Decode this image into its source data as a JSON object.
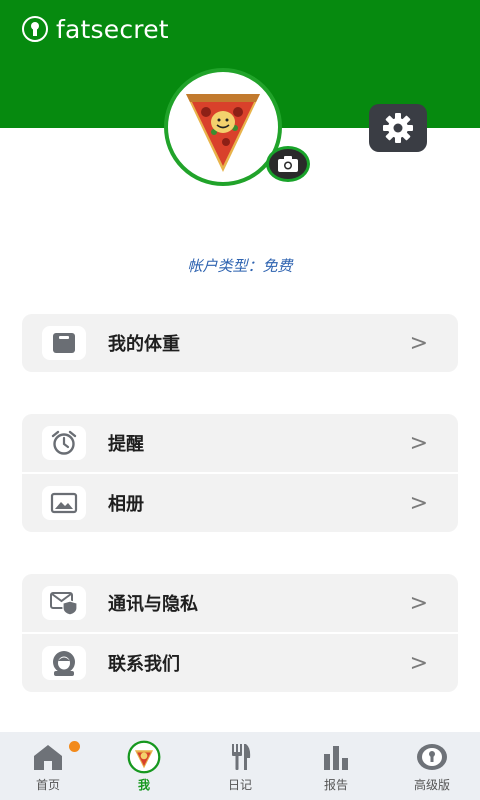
{
  "app": {
    "logo_text": "fatsecret"
  },
  "profile": {
    "account_type": "帐户类型：免费"
  },
  "menu": {
    "group1": [
      {
        "label": "我的体重",
        "icon": "scale-icon"
      }
    ],
    "group2": [
      {
        "label": "提醒",
        "icon": "alarm-clock-icon"
      },
      {
        "label": "相册",
        "icon": "photo-album-icon"
      }
    ],
    "group3": [
      {
        "label": "通讯与隐私",
        "icon": "mail-shield-icon"
      },
      {
        "label": "联系我们",
        "icon": "contact-support-icon"
      }
    ],
    "chevron": ">"
  },
  "tabs": [
    {
      "label": "首页",
      "icon": "home-icon"
    },
    {
      "label": "我",
      "icon": "pizza-avatar-icon"
    },
    {
      "label": "日记",
      "icon": "fork-knife-icon"
    },
    {
      "label": "报告",
      "icon": "bar-chart-icon"
    },
    {
      "label": "高级版",
      "icon": "premium-badge-icon"
    }
  ],
  "colors": {
    "brand_green": "#068A0F",
    "active_tab": "#16981F",
    "account_type_text": "#2E63B0",
    "notification_dot": "#F28A1B"
  }
}
